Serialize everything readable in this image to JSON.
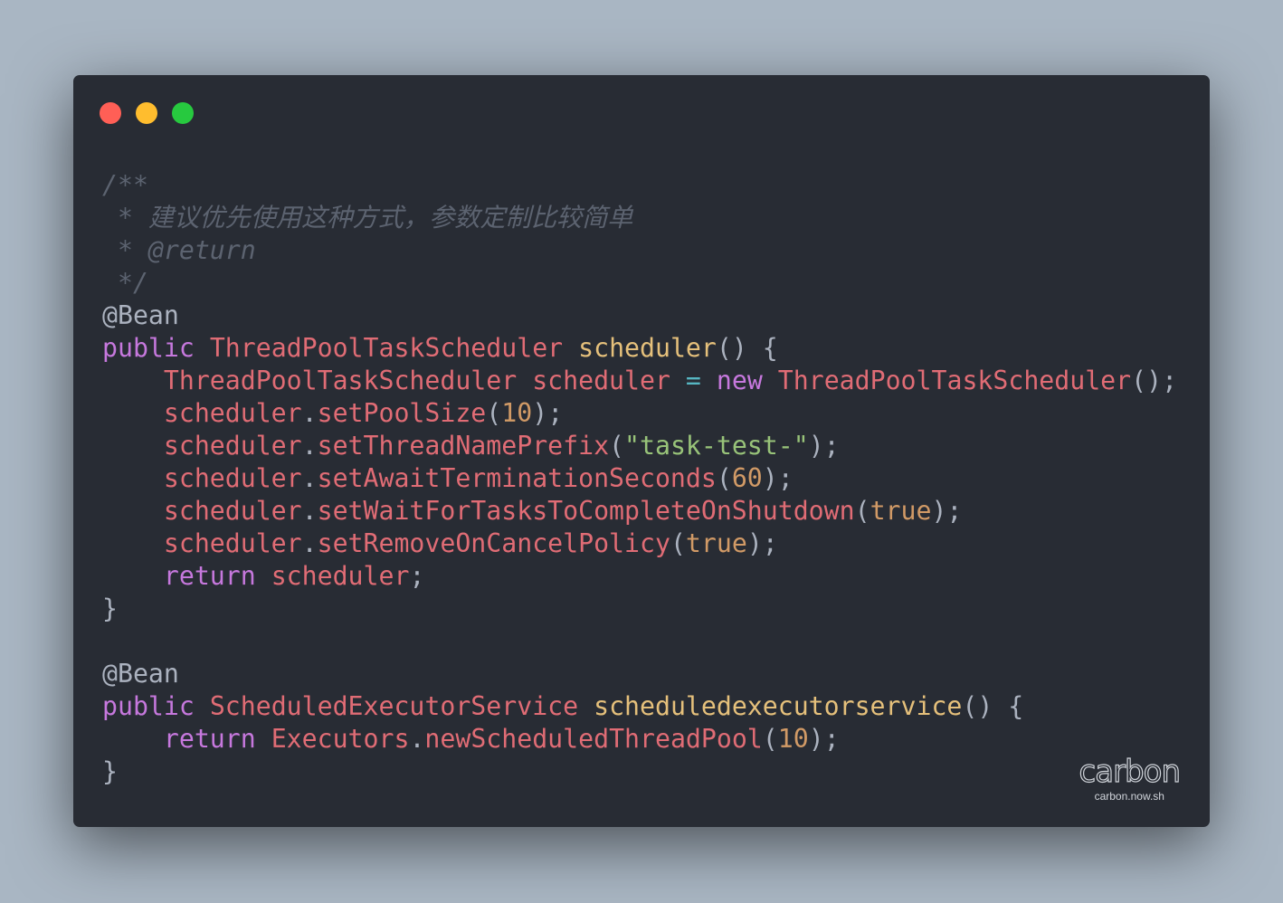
{
  "window_controls": [
    {
      "name": "close",
      "color": "#ff5f56"
    },
    {
      "name": "minimize",
      "color": "#ffbd2e"
    },
    {
      "name": "zoom",
      "color": "#27c93f"
    }
  ],
  "theme_colors": {
    "background": "#282c34",
    "comment": "#5c6370",
    "keyword": "#c678dd",
    "type": "#e06c75",
    "function": "#e5c07b",
    "string": "#98c379",
    "number": "#d19a66",
    "operator": "#56b6c2",
    "plain": "#abb2bf"
  },
  "code_lines": [
    [
      {
        "t": "/**",
        "k": "comment"
      }
    ],
    [
      {
        "t": " * 建议优先使用这种方式，参数定制比较简单",
        "k": "comment"
      }
    ],
    [
      {
        "t": " * @return",
        "k": "comment"
      }
    ],
    [
      {
        "t": " */",
        "k": "comment"
      }
    ],
    [
      {
        "t": "@Bean",
        "k": "plain"
      }
    ],
    [
      {
        "t": "public",
        "k": "keyword"
      },
      {
        "t": " ",
        "k": "plain"
      },
      {
        "t": "ThreadPoolTaskScheduler",
        "k": "type"
      },
      {
        "t": " ",
        "k": "plain"
      },
      {
        "t": "scheduler",
        "k": "function"
      },
      {
        "t": "() {",
        "k": "plain"
      }
    ],
    [
      {
        "t": "    ",
        "k": "plain"
      },
      {
        "t": "ThreadPoolTaskScheduler",
        "k": "type"
      },
      {
        "t": " ",
        "k": "plain"
      },
      {
        "t": "scheduler",
        "k": "type"
      },
      {
        "t": " ",
        "k": "plain"
      },
      {
        "t": "=",
        "k": "operator"
      },
      {
        "t": " ",
        "k": "plain"
      },
      {
        "t": "new",
        "k": "keyword"
      },
      {
        "t": " ",
        "k": "plain"
      },
      {
        "t": "ThreadPoolTaskScheduler",
        "k": "type"
      },
      {
        "t": "();",
        "k": "plain"
      }
    ],
    [
      {
        "t": "    ",
        "k": "plain"
      },
      {
        "t": "scheduler",
        "k": "type"
      },
      {
        "t": ".",
        "k": "plain"
      },
      {
        "t": "setPoolSize",
        "k": "type"
      },
      {
        "t": "(",
        "k": "plain"
      },
      {
        "t": "10",
        "k": "number"
      },
      {
        "t": ");",
        "k": "plain"
      }
    ],
    [
      {
        "t": "    ",
        "k": "plain"
      },
      {
        "t": "scheduler",
        "k": "type"
      },
      {
        "t": ".",
        "k": "plain"
      },
      {
        "t": "setThreadNamePrefix",
        "k": "type"
      },
      {
        "t": "(",
        "k": "plain"
      },
      {
        "t": "\"task-test-\"",
        "k": "string"
      },
      {
        "t": ");",
        "k": "plain"
      }
    ],
    [
      {
        "t": "    ",
        "k": "plain"
      },
      {
        "t": "scheduler",
        "k": "type"
      },
      {
        "t": ".",
        "k": "plain"
      },
      {
        "t": "setAwaitTerminationSeconds",
        "k": "type"
      },
      {
        "t": "(",
        "k": "plain"
      },
      {
        "t": "60",
        "k": "number"
      },
      {
        "t": ");",
        "k": "plain"
      }
    ],
    [
      {
        "t": "    ",
        "k": "plain"
      },
      {
        "t": "scheduler",
        "k": "type"
      },
      {
        "t": ".",
        "k": "plain"
      },
      {
        "t": "setWaitForTasksToCompleteOnShutdown",
        "k": "type"
      },
      {
        "t": "(",
        "k": "plain"
      },
      {
        "t": "true",
        "k": "number"
      },
      {
        "t": ");",
        "k": "plain"
      }
    ],
    [
      {
        "t": "    ",
        "k": "plain"
      },
      {
        "t": "scheduler",
        "k": "type"
      },
      {
        "t": ".",
        "k": "plain"
      },
      {
        "t": "setRemoveOnCancelPolicy",
        "k": "type"
      },
      {
        "t": "(",
        "k": "plain"
      },
      {
        "t": "true",
        "k": "number"
      },
      {
        "t": ");",
        "k": "plain"
      }
    ],
    [
      {
        "t": "    ",
        "k": "plain"
      },
      {
        "t": "return",
        "k": "keyword"
      },
      {
        "t": " ",
        "k": "plain"
      },
      {
        "t": "scheduler",
        "k": "type"
      },
      {
        "t": ";",
        "k": "plain"
      }
    ],
    [
      {
        "t": "}",
        "k": "plain"
      }
    ],
    [],
    [
      {
        "t": "@Bean",
        "k": "plain"
      }
    ],
    [
      {
        "t": "public",
        "k": "keyword"
      },
      {
        "t": " ",
        "k": "plain"
      },
      {
        "t": "ScheduledExecutorService",
        "k": "type"
      },
      {
        "t": " ",
        "k": "plain"
      },
      {
        "t": "scheduledexecutorservice",
        "k": "function"
      },
      {
        "t": "() {",
        "k": "plain"
      }
    ],
    [
      {
        "t": "    ",
        "k": "plain"
      },
      {
        "t": "return",
        "k": "keyword"
      },
      {
        "t": " ",
        "k": "plain"
      },
      {
        "t": "Executors",
        "k": "type"
      },
      {
        "t": ".",
        "k": "plain"
      },
      {
        "t": "newScheduledThreadPool",
        "k": "type"
      },
      {
        "t": "(",
        "k": "plain"
      },
      {
        "t": "10",
        "k": "number"
      },
      {
        "t": ");",
        "k": "plain"
      }
    ],
    [
      {
        "t": "}",
        "k": "plain"
      }
    ]
  ],
  "watermark": {
    "logo": "carbon",
    "url": "carbon.now.sh"
  }
}
